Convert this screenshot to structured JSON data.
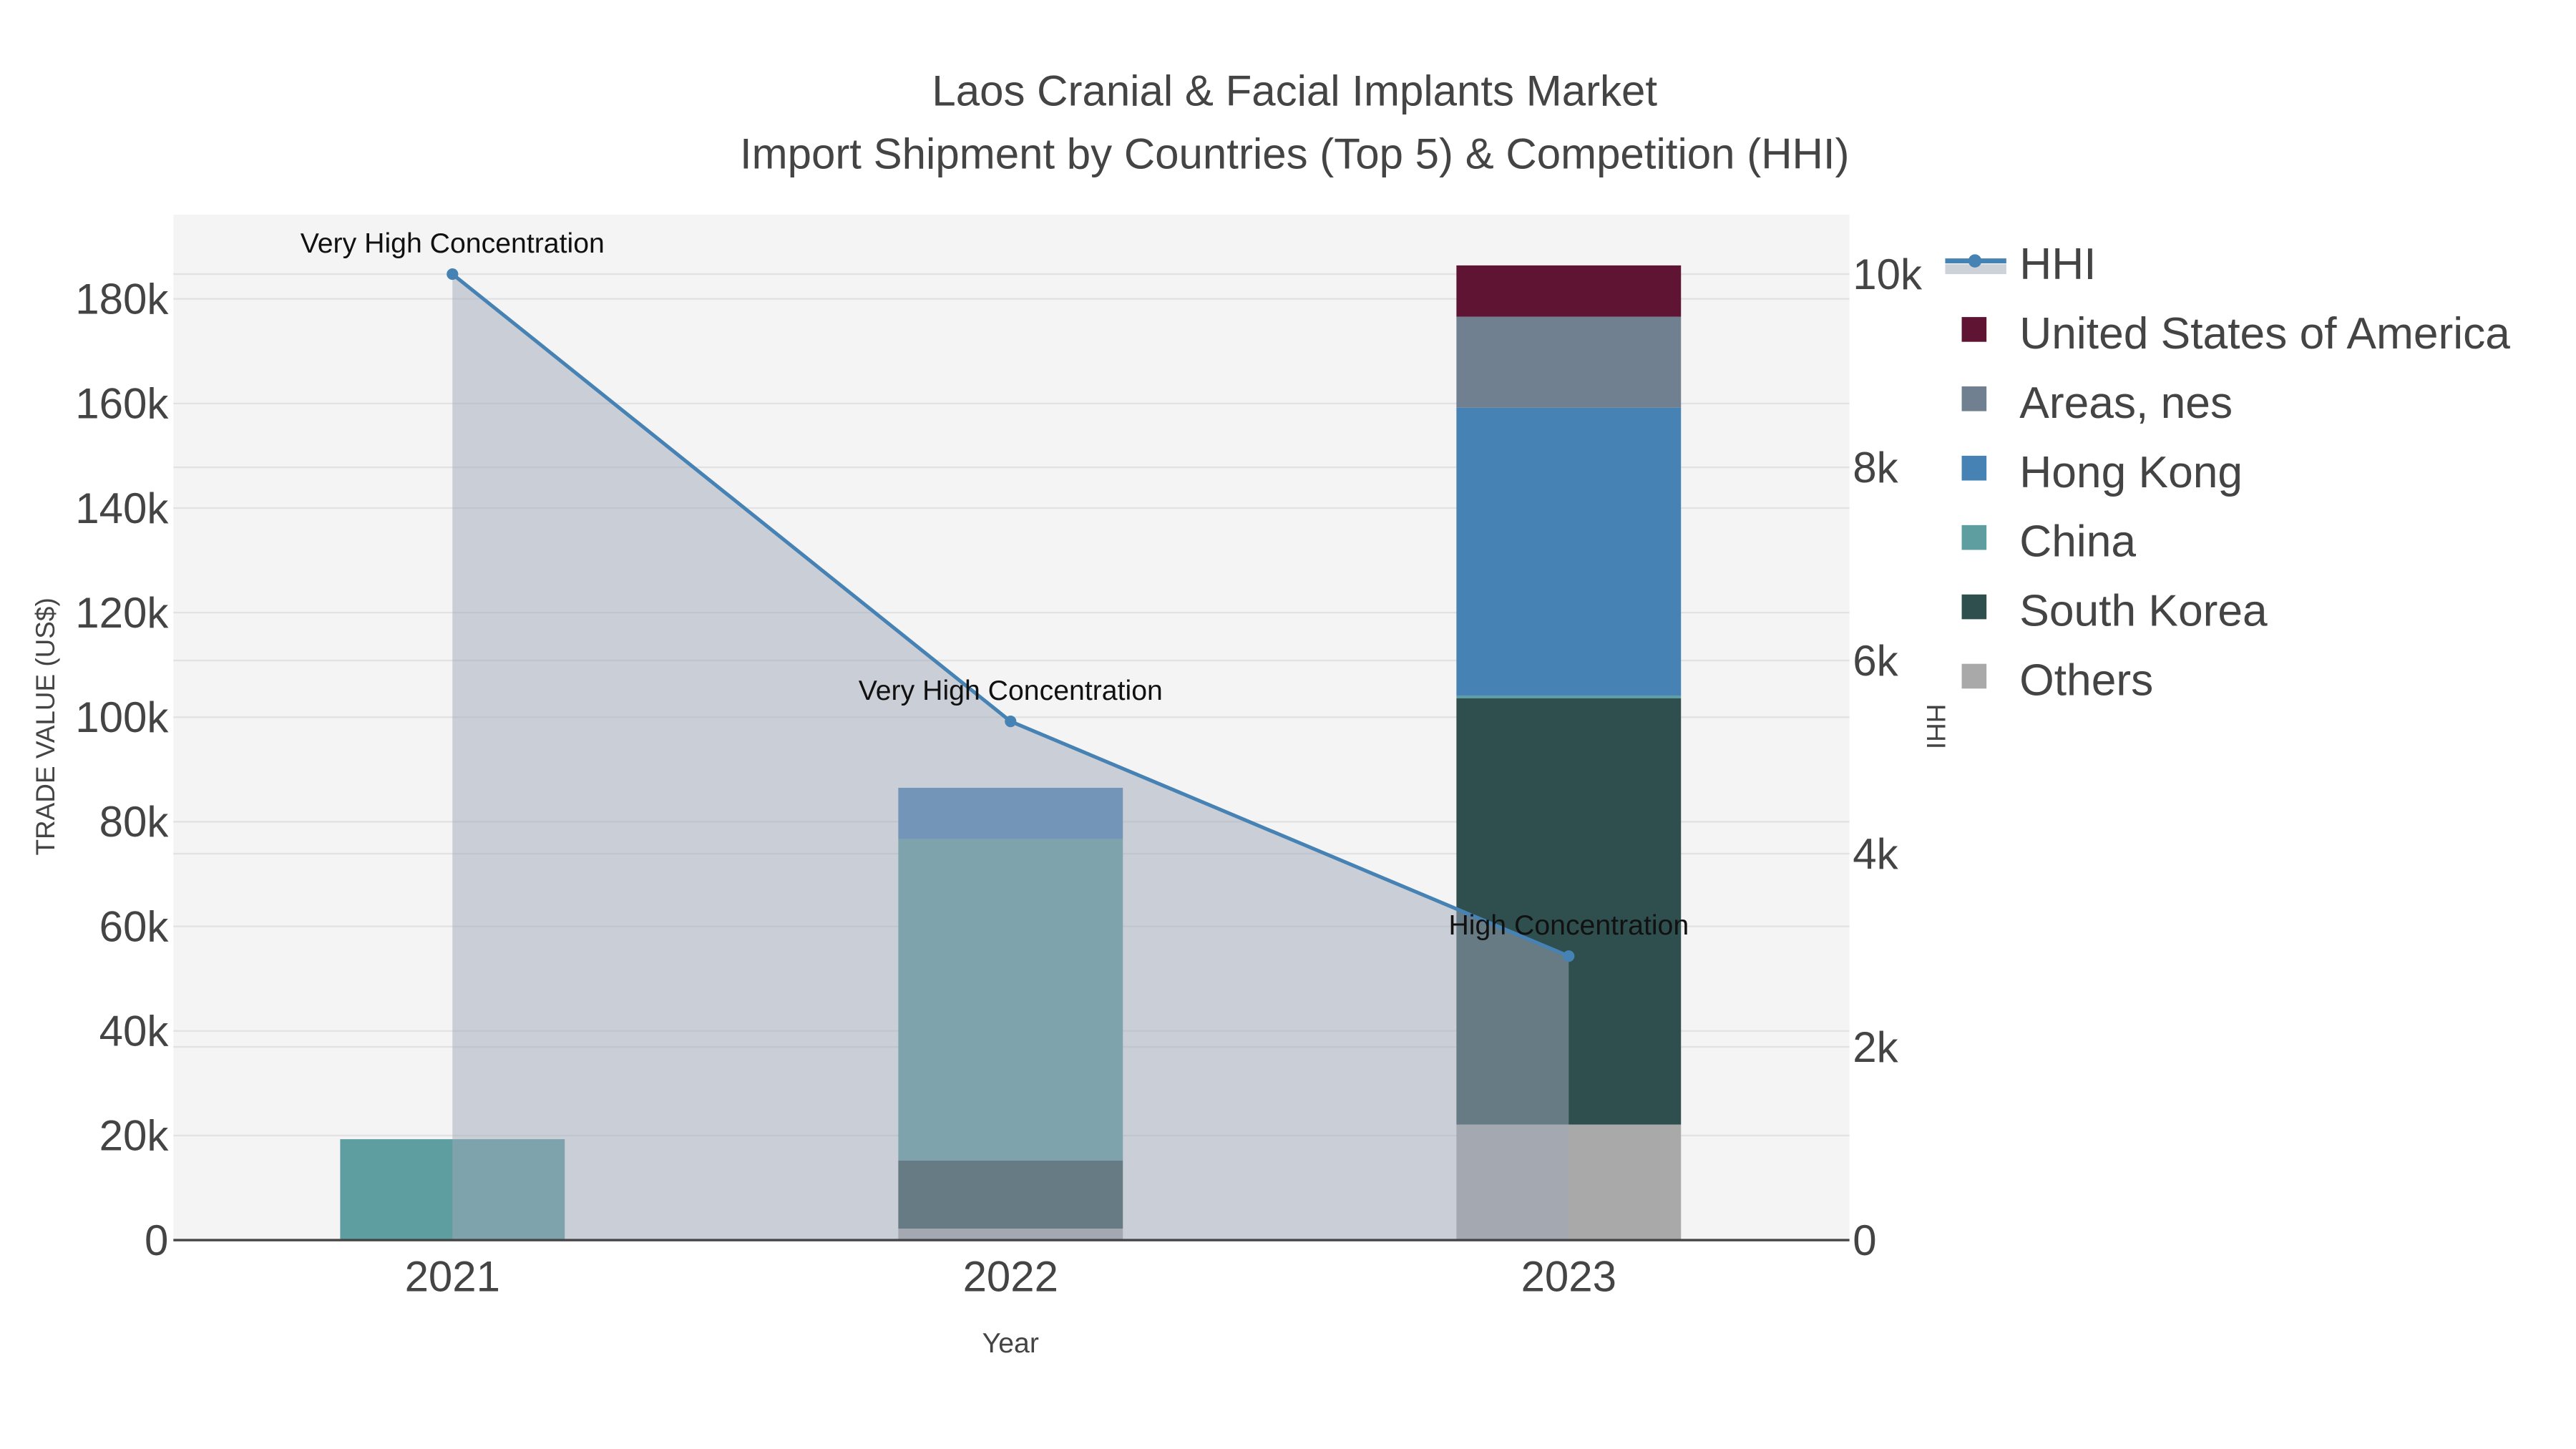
{
  "chart_data": {
    "type": "bar",
    "barmode": "stack",
    "title": "Laos Cranial & Facial Implants Market",
    "subtitle": "Import Shipment by Countries (Top 5) & Competition (HHI)",
    "xlabel": "Year",
    "ylabel": "TRADE VALUE (US$)",
    "y2label": "HHI",
    "categories": [
      "2021",
      "2022",
      "2023"
    ],
    "ylim": [
      0,
      190000
    ],
    "y_ticks": [
      0,
      20000,
      40000,
      60000,
      80000,
      100000,
      120000,
      140000,
      160000,
      180000
    ],
    "y_tick_labels": [
      "0",
      "20k",
      "40k",
      "60k",
      "80k",
      "100k",
      "120k",
      "140k",
      "160k",
      "180k"
    ],
    "y2lim": [
      0,
      10500
    ],
    "y2_ticks": [
      0,
      2000,
      4000,
      6000,
      8000,
      10000
    ],
    "y2_tick_labels": [
      "0",
      "2k",
      "4k",
      "6k",
      "8k",
      "10k"
    ],
    "grid": true,
    "legend_position": "right",
    "series": [
      {
        "name": "Others",
        "color": "#a9a9a9",
        "values": [
          0,
          2200,
          22100
        ]
      },
      {
        "name": "South Korea",
        "color": "#2f4f4f",
        "values": [
          0,
          13000,
          81500
        ]
      },
      {
        "name": "China",
        "color": "#5f9ea0",
        "values": [
          19300,
          61500,
          500
        ]
      },
      {
        "name": "Hong Kong",
        "color": "#4682b4",
        "values": [
          0,
          9800,
          55100
        ]
      },
      {
        "name": "Areas, nes",
        "color": "#708090",
        "values": [
          0,
          0,
          17400
        ]
      },
      {
        "name": "United States of America",
        "color": "#601434",
        "values": [
          0,
          0,
          9800
        ]
      }
    ],
    "line": {
      "name": "HHI",
      "color": "#4682b4",
      "axis": "y2",
      "values": [
        10000,
        5370,
        2940
      ],
      "annotations": [
        "Very High Concentration",
        "Very High Concentration",
        "High Concentration"
      ]
    },
    "legend_order": [
      "HHI",
      "United States of America",
      "Areas, nes",
      "Hong Kong",
      "China",
      "South Korea",
      "Others"
    ]
  }
}
